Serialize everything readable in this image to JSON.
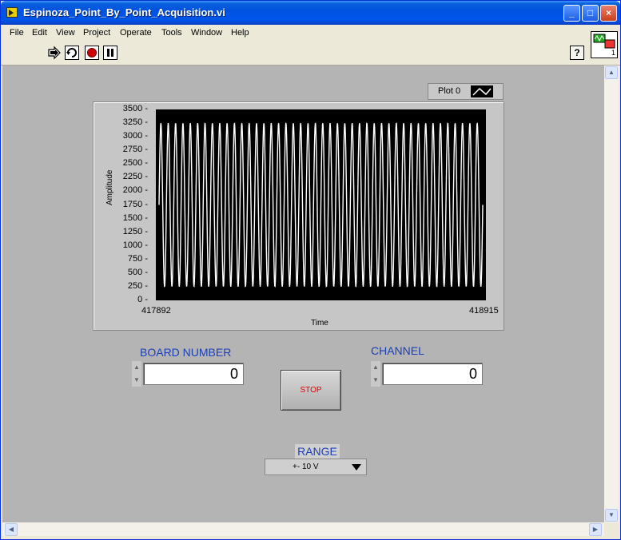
{
  "window": {
    "title": "Espinoza_Point_By_Point_Acquisition.vi"
  },
  "menu": [
    "File",
    "Edit",
    "View",
    "Project",
    "Operate",
    "Tools",
    "Window",
    "Help"
  ],
  "toolbar": {
    "run": "run-arrow-icon",
    "run_continuously": "run-continuously-icon",
    "abort": "abort-icon",
    "pause": "pause-icon",
    "help": "?"
  },
  "vi_icon_number": "1",
  "graph": {
    "legend_label": "Plot 0",
    "ylabel": "Amplitude",
    "xlabel": "Time",
    "yticks": [
      "3500",
      "3250",
      "3000",
      "2750",
      "2500",
      "2250",
      "2000",
      "1750",
      "1500",
      "1250",
      "1000",
      "750",
      "500",
      "250",
      "0"
    ],
    "xtick_start": "417892",
    "xtick_end": "418915"
  },
  "chart_data": {
    "type": "line",
    "title": "",
    "xlabel": "Time",
    "ylabel": "Amplitude",
    "xlim": [
      417892,
      418915
    ],
    "ylim": [
      0,
      3500
    ],
    "grid": false,
    "series": [
      {
        "name": "Plot 0",
        "kind": "sine",
        "x_start": 417892,
        "x_end": 418915,
        "min": 250,
        "max": 3250,
        "cycles": 44,
        "color": "#ffffff"
      }
    ]
  },
  "controls": {
    "board_number_label": "BOARD NUMBER",
    "board_number_value": "0",
    "channel_label": "CHANNEL",
    "channel_value": "0",
    "stop_label": "STOP",
    "range_label": "RANGE",
    "range_value": "+- 10 V"
  },
  "colors": {
    "panel": "#b4b4b4",
    "label_blue": "#1c3fb7",
    "stop_text": "#e00000",
    "plot_bg": "#000000",
    "trace": "#ffffff"
  }
}
